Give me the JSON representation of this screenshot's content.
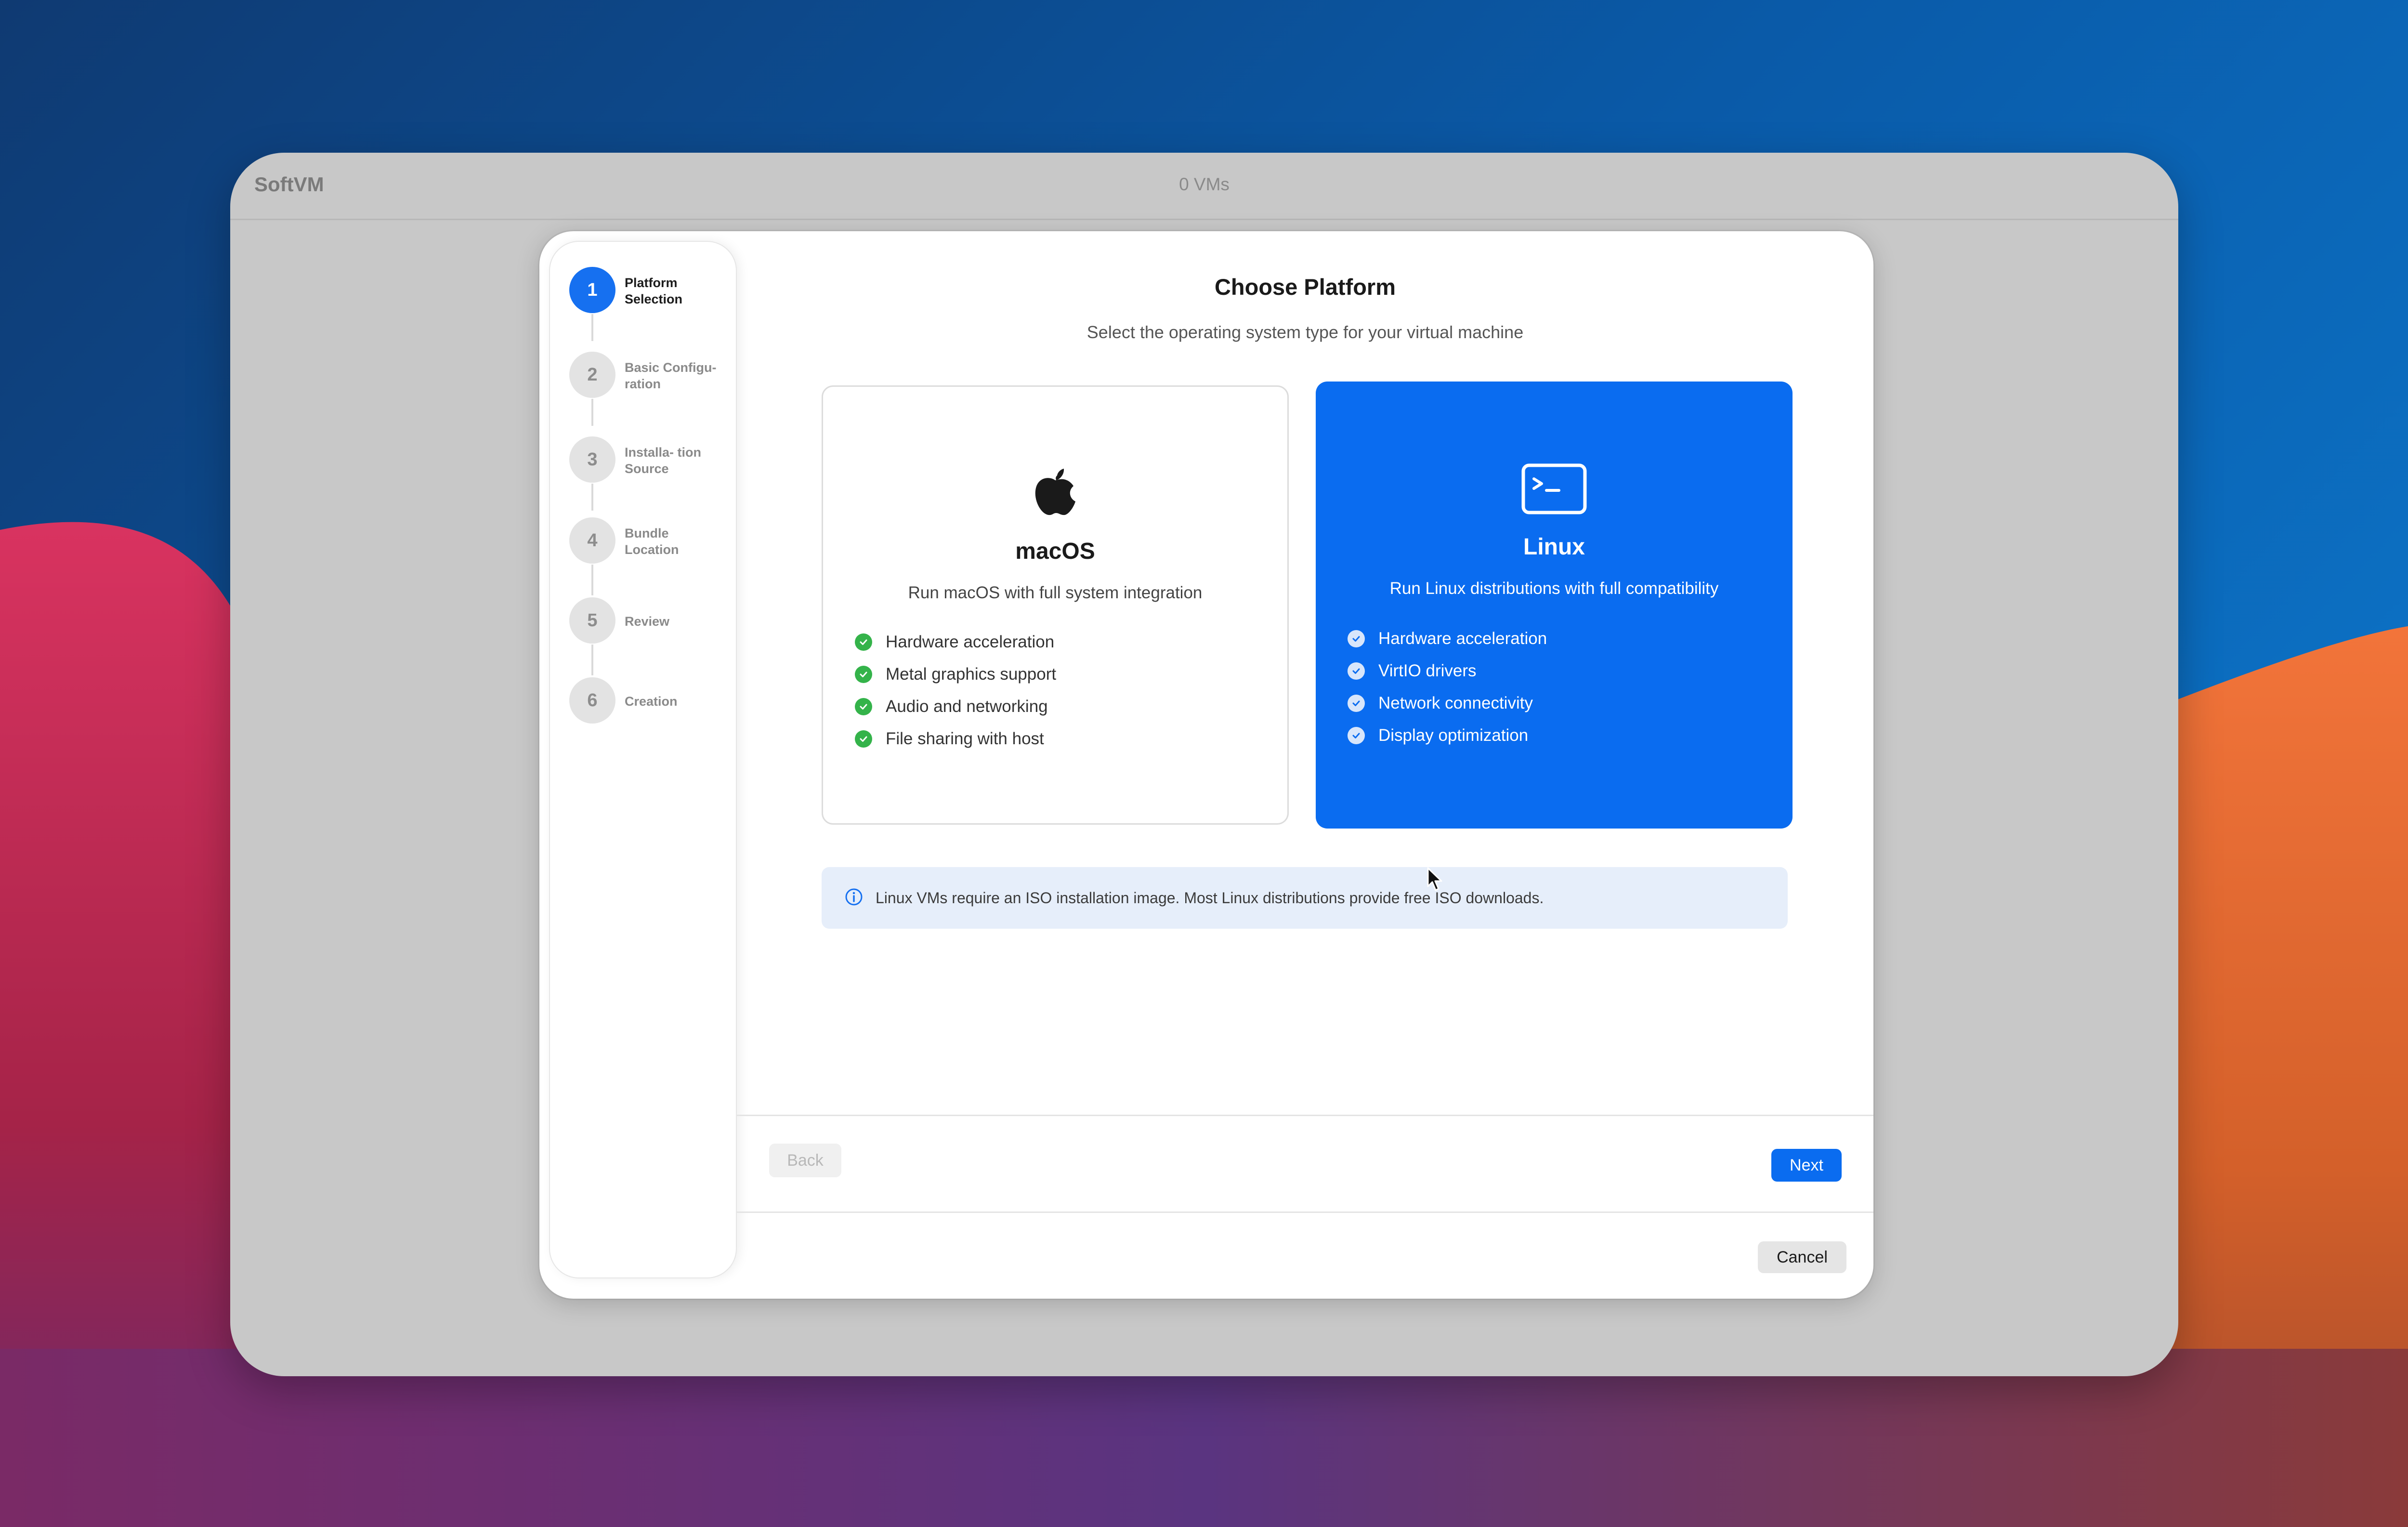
{
  "app": {
    "title": "SoftVM",
    "vm_count": "0 VMs"
  },
  "wizard": {
    "steps": [
      {
        "number": "1",
        "label": "Platform Selection",
        "active": true
      },
      {
        "number": "2",
        "label": "Basic Configu- ration",
        "active": false
      },
      {
        "number": "3",
        "label": "Installa- tion Source",
        "active": false
      },
      {
        "number": "4",
        "label": "Bundle Location",
        "active": false
      },
      {
        "number": "5",
        "label": "Review",
        "active": false
      },
      {
        "number": "6",
        "label": "Creation",
        "active": false
      }
    ],
    "title": "Choose Platform",
    "subtitle": "Select the operating system type for your virtual machine",
    "platforms": {
      "macos": {
        "name": "macOS",
        "description": "Run macOS with full system integration",
        "icon": "apple-logo-icon",
        "selected": false,
        "features": [
          "Hardware acceleration",
          "Metal graphics support",
          "Audio and networking",
          "File sharing with host"
        ]
      },
      "linux": {
        "name": "Linux",
        "description": "Run Linux distributions with full compatibility",
        "icon": "terminal-icon",
        "selected": true,
        "features": [
          "Hardware acceleration",
          "VirtIO drivers",
          "Network connectivity",
          "Display optimization"
        ]
      }
    },
    "info": {
      "icon": "info-icon",
      "text": "Linux VMs require an ISO installation image. Most Linux distributions provide free ISO downloads."
    },
    "buttons": {
      "back": "Back",
      "next": "Next",
      "cancel": "Cancel"
    }
  },
  "colors": {
    "accent": "#0a6cf0",
    "check_green": "#34b34a",
    "info_background": "#e6eefa"
  }
}
